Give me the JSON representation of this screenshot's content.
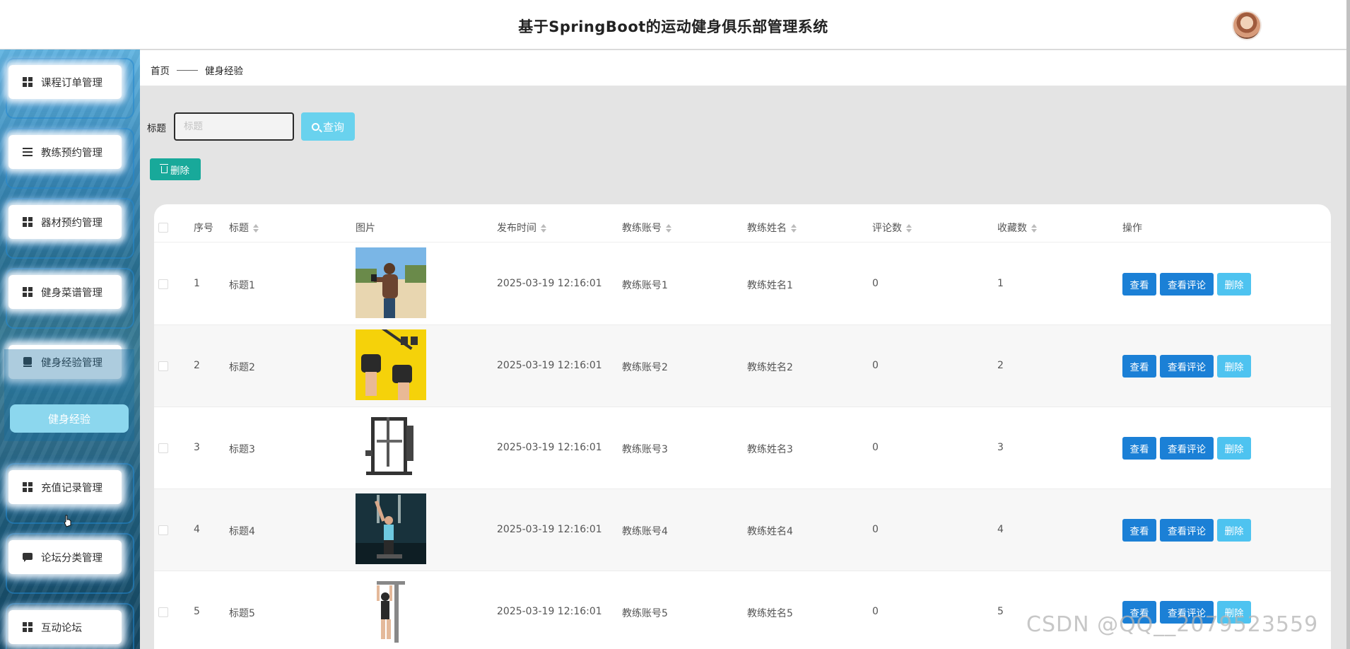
{
  "header": {
    "title": "基于SpringBoot的运动健身俱乐部管理系统"
  },
  "sidebar": {
    "items": [
      {
        "label": "课程订单管理",
        "icon": "grid-icon"
      },
      {
        "label": "教练预约管理",
        "icon": "list-icon"
      },
      {
        "label": "器材预约管理",
        "icon": "grid-icon"
      },
      {
        "label": "健身菜谱管理",
        "icon": "grid-icon"
      },
      {
        "label": "健身经验管理",
        "icon": "book-icon"
      },
      {
        "label": "充值记录管理",
        "icon": "grid-icon"
      },
      {
        "label": "论坛分类管理",
        "icon": "chat-icon"
      },
      {
        "label": "互动论坛",
        "icon": "grid-icon"
      }
    ],
    "active_sub": "健身经验"
  },
  "breadcrumb": {
    "home": "首页",
    "current": "健身经验"
  },
  "search": {
    "label": "标题",
    "placeholder": "标题",
    "button": "查询"
  },
  "toolbar": {
    "delete_label": "删除"
  },
  "table": {
    "headers": [
      "序号",
      "标题",
      "图片",
      "发布时间",
      "教练账号",
      "教练姓名",
      "评论数",
      "收藏数",
      "操作"
    ],
    "actions": {
      "view": "查看",
      "comments": "查看评论",
      "delete": "删除"
    },
    "rows": [
      {
        "index": "1",
        "title": "标题1",
        "time": "2025-03-19 12:16:01",
        "account": "教练账号1",
        "name": "教练姓名1",
        "comments": "0",
        "favorites": "1"
      },
      {
        "index": "2",
        "title": "标题2",
        "time": "2025-03-19 12:16:01",
        "account": "教练账号2",
        "name": "教练姓名2",
        "comments": "0",
        "favorites": "2"
      },
      {
        "index": "3",
        "title": "标题3",
        "time": "2025-03-19 12:16:01",
        "account": "教练账号3",
        "name": "教练姓名3",
        "comments": "0",
        "favorites": "3"
      },
      {
        "index": "4",
        "title": "标题4",
        "time": "2025-03-19 12:16:01",
        "account": "教练账号4",
        "name": "教练姓名4",
        "comments": "0",
        "favorites": "4"
      },
      {
        "index": "5",
        "title": "标题5",
        "time": "2025-03-19 12:16:01",
        "account": "教练账号5",
        "name": "教练姓名5",
        "comments": "0",
        "favorites": "5"
      }
    ]
  },
  "watermark": "CSDN @QQ__2079523559",
  "colors": {
    "primary": "#1b80d6",
    "danger_light": "#4ec3f0",
    "teal": "#18a99a",
    "search": "#69d2ee"
  }
}
